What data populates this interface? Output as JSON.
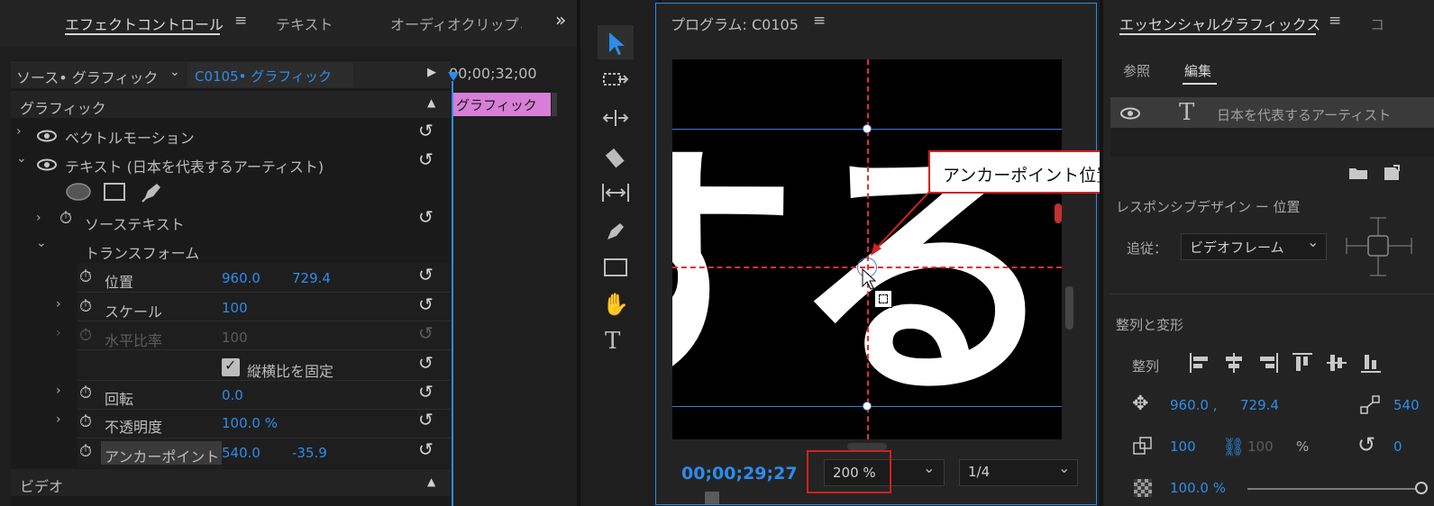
{
  "effect_panel": {
    "tabs": [
      "エフェクトコントロール",
      "テキスト",
      "オーディオクリップミ"
    ],
    "source_label": "ソース• グラフィック",
    "clip_label": "C0105• グラフィック",
    "timecode": "00;00;32;00",
    "clip_block_label": "グラフィック",
    "section_graphic": "グラフィック",
    "vector_motion": "ベクトルモーション",
    "text_layer": "テキスト (日本を代表するアーティスト)",
    "source_text": "ソーステキスト",
    "transform": "トランスフォーム",
    "position_label": "位置",
    "position_x": "960.0",
    "position_y": "729.4",
    "scale_label": "スケール",
    "scale_value": "100",
    "hscale_label": "水平比率",
    "hscale_value": "100",
    "uniform_label": "縦横比を固定",
    "rotation_label": "回転",
    "rotation_value": "0.0",
    "opacity_label": "不透明度",
    "opacity_value": "100.0 %",
    "anchor_label": "アンカーポイント",
    "anchor_x": "540.0",
    "anchor_y": "-35.9",
    "video_section": "ビデオ"
  },
  "program": {
    "title": "プログラム: C0105",
    "timecode": "00;00;29;27",
    "zoom": "200 %",
    "resolution": "1/4",
    "preview_text": "する",
    "callout": "アンカーポイント位置を確認"
  },
  "essential": {
    "title": "エッセンシャルグラフィックス",
    "tab_browse": "参照",
    "tab_edit": "編集",
    "layer_name": "日本を代表するアーティスト",
    "responsive": "レスポンシブデザイン ー 位置",
    "follow_label": "追従：",
    "follow_value": "ビデオフレーム",
    "align_section": "整列と変形",
    "align_label": "整列",
    "pos_x": "960.0 ,",
    "pos_y": "729.4",
    "pos_right": "540",
    "scale_value": "100",
    "scale_dim": "100",
    "percent": "%",
    "rotate_value": "0",
    "opacity_value": "100.0 %"
  },
  "colors": {
    "accent_blue": "#2d8ceb",
    "clip_pink": "#d77ed7",
    "callout_red": "#d42020",
    "guide_red": "#e03030"
  }
}
